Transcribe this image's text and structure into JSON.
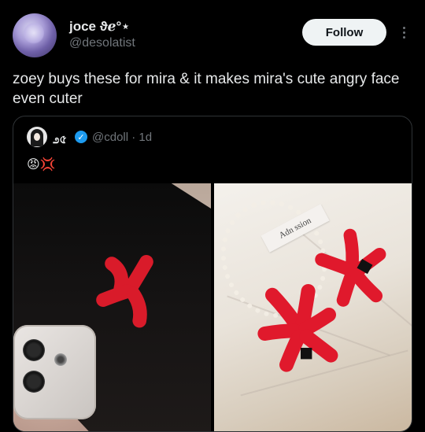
{
  "author": {
    "display_name": "joce ϑℯ°⋆",
    "handle": "@desolatist"
  },
  "actions": {
    "follow_label": "Follow"
  },
  "tweet": {
    "text": "zoey buys these for mira & it makes mira's cute angry face even cuter"
  },
  "quoted": {
    "display_name": "೨৫",
    "handle_time": "@cdoll · 1d",
    "emoji_text": "😡💢",
    "image_right_tag": "Adn  ssion"
  },
  "colors": {
    "background": "#000000",
    "follow_button": "#eff3f4",
    "verified_badge": "#1d9bf0",
    "clip_red": "#d91b2a"
  },
  "icons": [
    "avatar",
    "more-icon",
    "verified-icon",
    "angry-face-emoji",
    "anger-symbol-emoji"
  ]
}
